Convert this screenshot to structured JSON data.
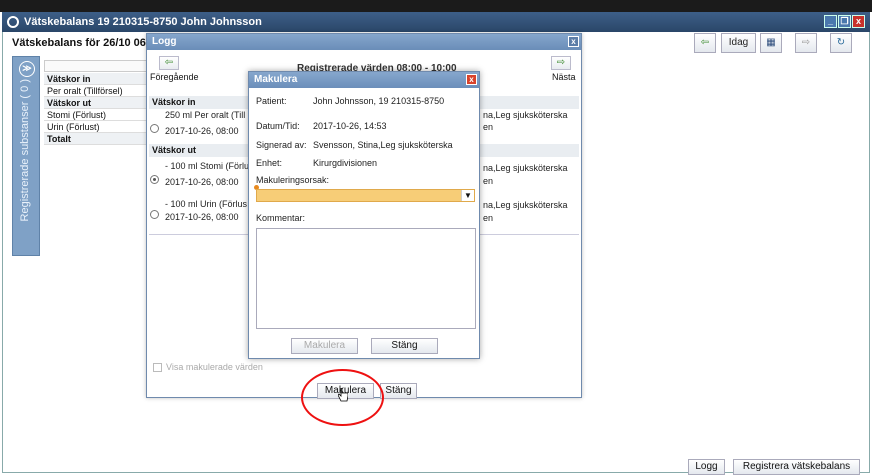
{
  "window": {
    "title": "Vätskebalans 19 210315-8750 John Johnsson",
    "subheader": "Vätskebalans för 26/10 06:",
    "controls": {
      "min": "_",
      "max": "❐",
      "close": "x"
    }
  },
  "toolbar": {
    "prev": "⇦",
    "today": "Idag",
    "calendar": "▦",
    "next": "⇨",
    "refresh": "↻"
  },
  "sidebar_tab": {
    "count": "( 0 )",
    "label": "Registrerade substanser",
    "toggle": "≫"
  },
  "left_table": {
    "rows": [
      {
        "text": "Vätskor in",
        "bold": true
      },
      {
        "text": "Per oralt (Tillförsel)",
        "bold": false
      },
      {
        "text": "Vätskor ut",
        "bold": true
      },
      {
        "text": "Stomi (Förlust)",
        "bold": false
      },
      {
        "text": "Urin (Förlust)",
        "bold": false
      },
      {
        "text": "Totalt",
        "bold": true
      }
    ]
  },
  "logg": {
    "title": "Logg",
    "close": "x",
    "prev_label": "Föregående",
    "next_label": "Nästa",
    "range": "Registrerade värden 08:00 - 10:00",
    "section_in": "Vätskor in",
    "section_out": "Vätskor ut",
    "entries": [
      {
        "line1": "250 ml Per oralt (Till",
        "line2": "2017-10-26, 08:00",
        "right1": "na,Leg sjuksköterska",
        "right2": "en"
      },
      {
        "line1": "- 100 ml Stomi (Förlu",
        "line2": "2017-10-26, 08:00",
        "right1": "na,Leg sjuksköterska",
        "right2": "en"
      },
      {
        "line1": "- 100 ml Urin (Förlus",
        "line2": "2017-10-26, 08:00",
        "right1": "na,Leg sjuksköterska",
        "right2": "en"
      }
    ],
    "show_voided": "Visa makulerade värden",
    "btn_makulera": "Makulera",
    "btn_stang": "Stäng"
  },
  "makulera": {
    "title": "Makulera",
    "close": "x",
    "fields": [
      {
        "label": "Patient:",
        "value": "John Johnsson, 19 210315-8750"
      },
      {
        "label": "Datum/Tid:",
        "value": "2017-10-26, 14:53"
      },
      {
        "label": "Signerad av:",
        "value": "Svensson, Stina,Leg sjuksköterska"
      },
      {
        "label": "Enhet:",
        "value": "Kirurgdivisionen"
      }
    ],
    "reason_label": "Makuleringsorsak:",
    "dropdown_arrow": "▼",
    "comment_label": "Kommentar:",
    "btn_makulera": "Makulera",
    "btn_stang": "Stäng"
  },
  "footer": {
    "logg": "Logg",
    "register": "Registrera vätskebalans"
  }
}
